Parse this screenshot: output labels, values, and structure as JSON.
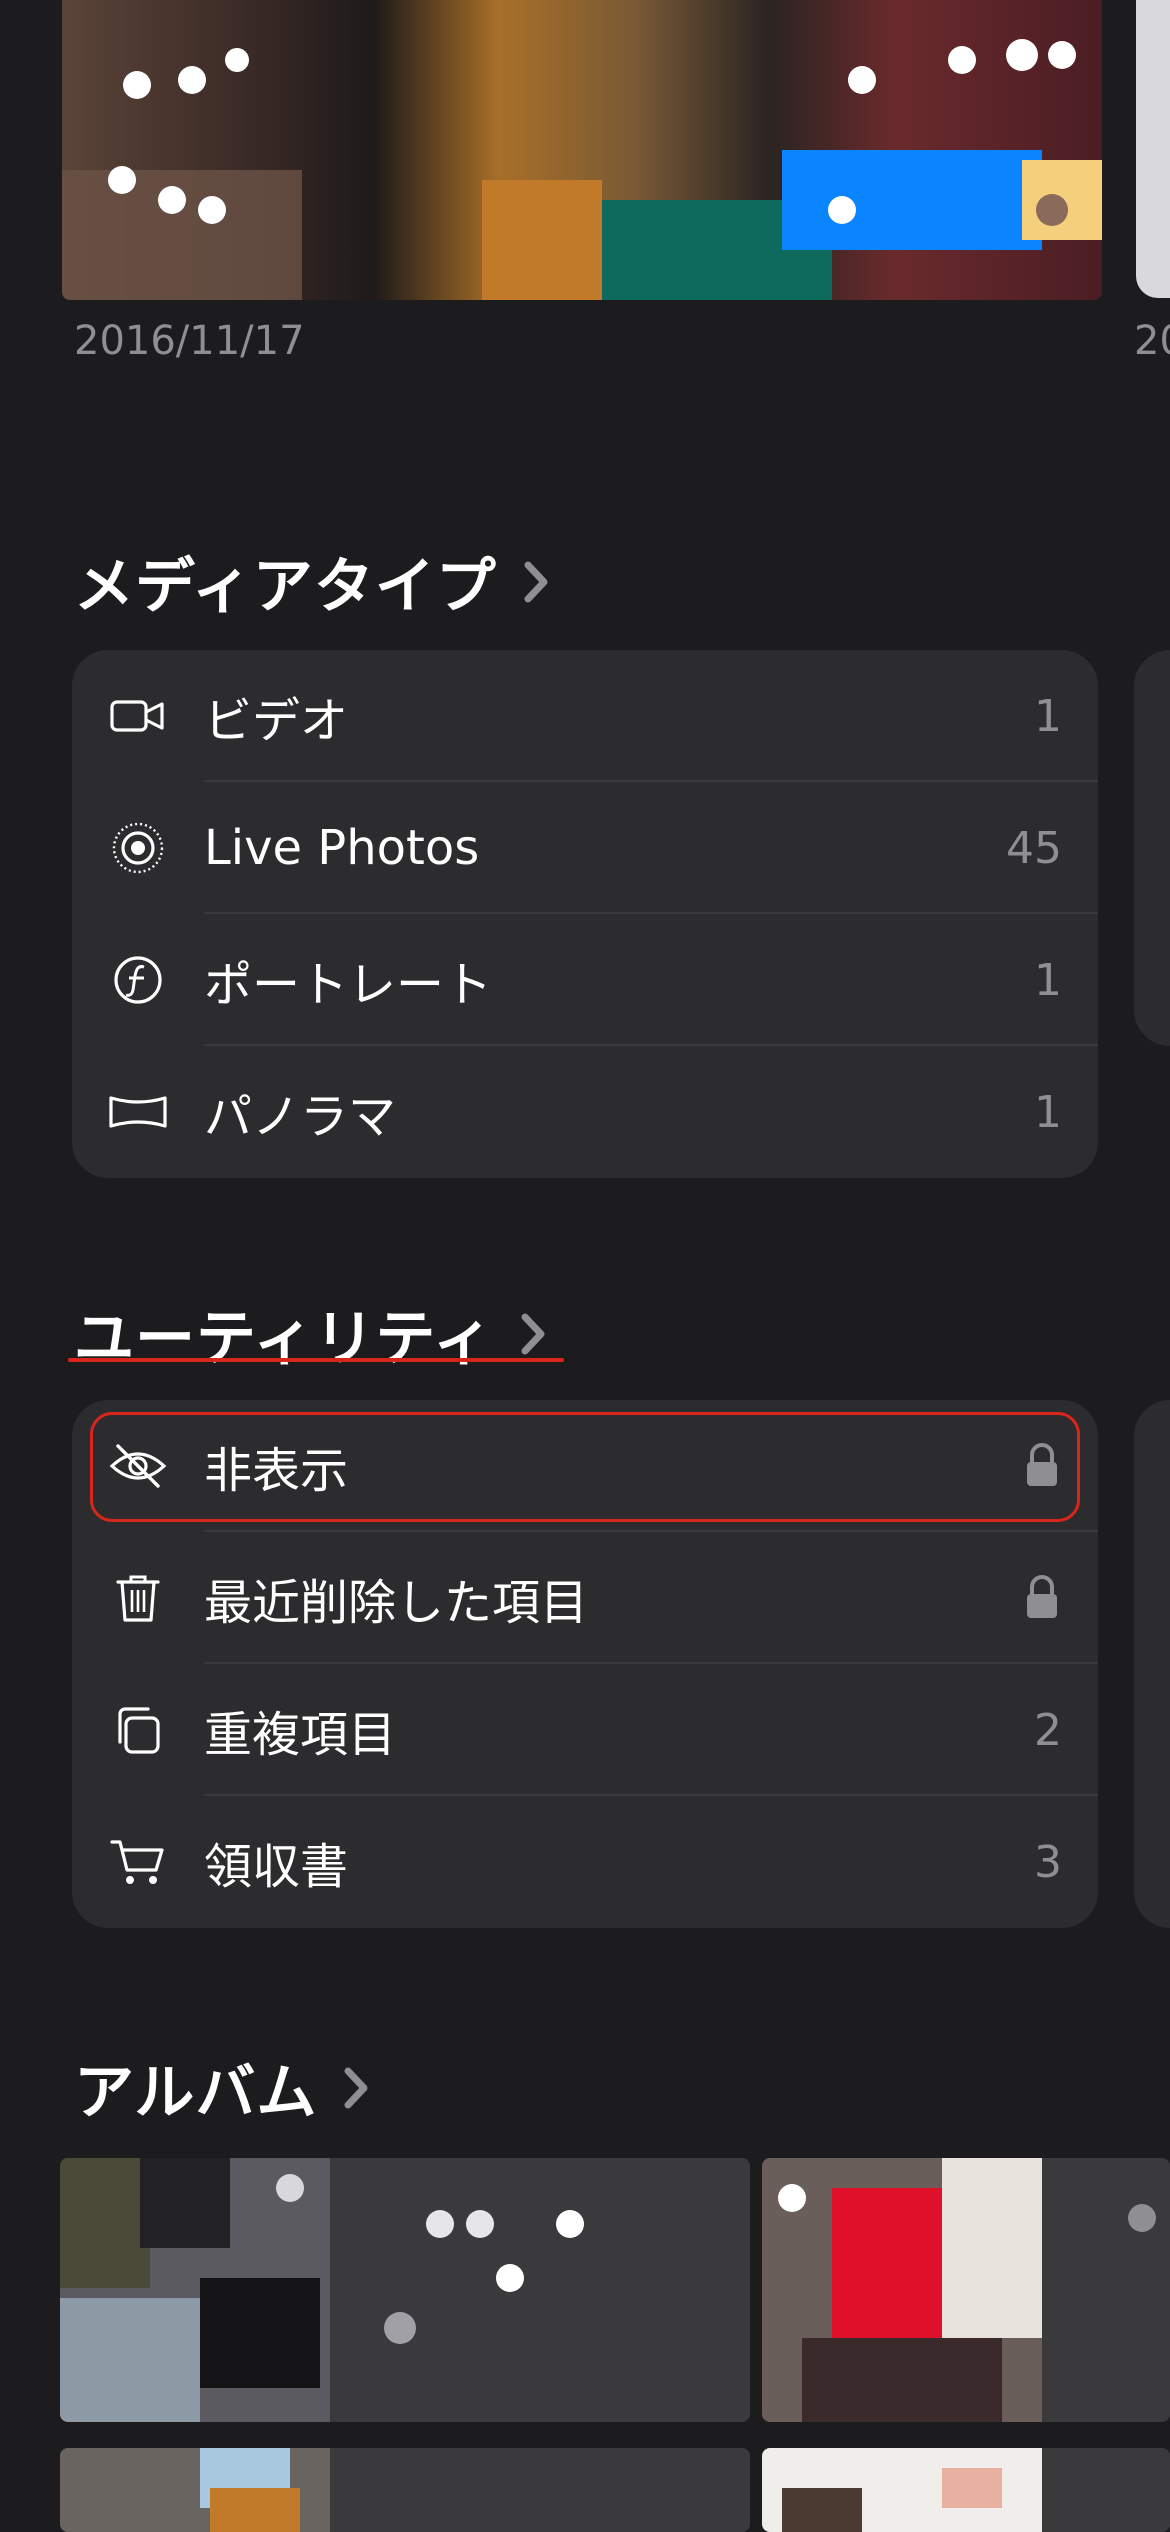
{
  "top_photos": {
    "date_1": "2016/11/17",
    "date_2": "20"
  },
  "media_types": {
    "title": "メディアタイプ",
    "items": [
      {
        "icon": "video-camera-icon",
        "label": "ビデオ",
        "count": "1"
      },
      {
        "icon": "live-photos-icon",
        "label": "Live Photos",
        "count": "45"
      },
      {
        "icon": "portrait-aperture-icon",
        "label": "ポートレート",
        "count": "1"
      },
      {
        "icon": "panorama-icon",
        "label": "パノラマ",
        "count": "1"
      }
    ]
  },
  "utilities": {
    "title": "ユーティリティ",
    "items": [
      {
        "icon": "eye-slash-icon",
        "label": "非表示",
        "trailing": "lock-icon"
      },
      {
        "icon": "trash-icon",
        "label": "最近削除した項目",
        "trailing": "lock-icon"
      },
      {
        "icon": "duplicate-icon",
        "label": "重複項目",
        "count": "2"
      },
      {
        "icon": "cart-icon",
        "label": "領収書",
        "count": "3"
      }
    ]
  },
  "albums": {
    "title": "アルバム"
  },
  "colors": {
    "background": "#1c1c1e",
    "card": "#2c2c2e",
    "secondary_text": "#8e8e93",
    "highlight_red": "#d9261c"
  }
}
